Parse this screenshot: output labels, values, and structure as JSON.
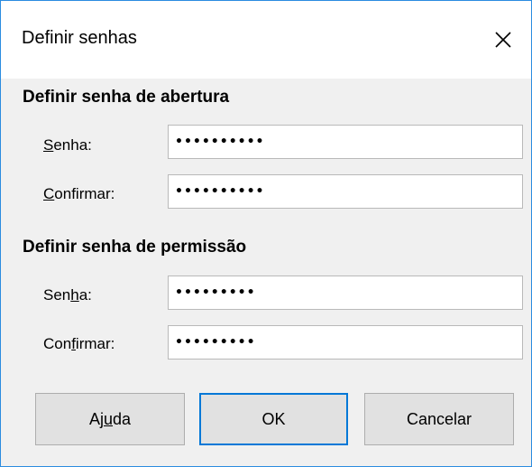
{
  "dialog": {
    "title": "Definir senhas",
    "close_icon": "close-icon"
  },
  "open_password": {
    "heading": "Definir senha de abertura",
    "password_label_pre": "",
    "password_label_accel": "S",
    "password_label_post": "enha:",
    "password_value": "••••••••••",
    "confirm_label_pre": "",
    "confirm_label_accel": "C",
    "confirm_label_post": "onfirmar:",
    "confirm_value": "••••••••••"
  },
  "permission_password": {
    "heading": "Definir senha de permissão",
    "password_label_pre": "Sen",
    "password_label_accel": "h",
    "password_label_post": "a:",
    "password_value": "•••••••••",
    "confirm_label_pre": "Con",
    "confirm_label_accel": "f",
    "confirm_label_post": "irmar:",
    "confirm_value": "•••••••••"
  },
  "buttons": {
    "help_pre": "Aj",
    "help_accel": "u",
    "help_post": "da",
    "ok": "OK",
    "cancel": "Cancelar"
  }
}
